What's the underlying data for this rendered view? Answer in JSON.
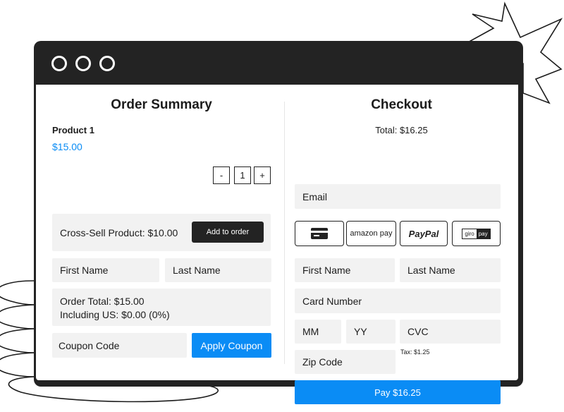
{
  "window": {
    "controls": [
      "control-1",
      "control-2",
      "control-3"
    ]
  },
  "order_summary": {
    "title": "Order Summary",
    "product": {
      "name": "Product 1",
      "price": "$15.00"
    },
    "quantity": {
      "minus": "-",
      "value": "1",
      "plus": "+"
    },
    "cross_sell": {
      "label": "Cross-Sell Product: $10.00",
      "button": "Add to order"
    },
    "first_name_placeholder": "First Name",
    "last_name_placeholder": "Last Name",
    "total_line": "Order Total: $15.00",
    "tax_line": "Including US: $0.00 (0%)",
    "coupon_placeholder": "Coupon Code",
    "apply_coupon": "Apply Coupon"
  },
  "checkout": {
    "title": "Checkout",
    "total": "Total: $16.25",
    "email_placeholder": "Email",
    "payment_methods": [
      {
        "name": "card",
        "icon": "credit-card-icon"
      },
      {
        "name": "amazon pay",
        "label": "amazon pay"
      },
      {
        "name": "PayPal",
        "label": "PayPal"
      },
      {
        "name": "giropay",
        "label_a": "giro",
        "label_b": "pay"
      }
    ],
    "first_name_placeholder": "First Name",
    "last_name_placeholder": "Last Name",
    "card_number_placeholder": "Card Number",
    "mm_placeholder": "MM",
    "yy_placeholder": "YY",
    "cvc_placeholder": "CVC",
    "tax_note": "Tax: $1.25",
    "zip_placeholder": "Zip Code",
    "pay_button": "Pay $16.25"
  },
  "colors": {
    "accent": "#0a8cf5",
    "dark": "#232323",
    "field": "#f2f2f2"
  }
}
